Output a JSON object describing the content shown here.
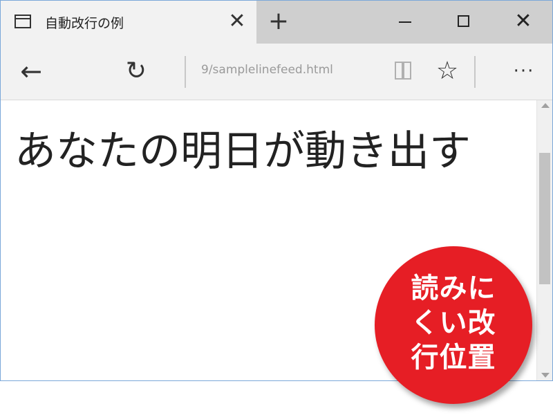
{
  "browser": {
    "tab": {
      "title": "自動改行の例",
      "close_glyph": "✕"
    },
    "new_tab_glyph": "+",
    "window_controls": {
      "close_glyph": "✕"
    },
    "nav": {
      "back_glyph": "←",
      "refresh_glyph": "↻",
      "address": "9/samplelinefeed.html",
      "favorite_glyph": "☆",
      "more_glyph": "···"
    }
  },
  "page": {
    "text": "あなたの明日が動き出す"
  },
  "badge": {
    "lines": [
      "読みに",
      "くい改",
      "行位置"
    ],
    "color": "#e61e25"
  },
  "colors": {
    "window_border": "#7aa7d9",
    "tab_active": "#f2f2f2",
    "tab_strip": "#cfcfcf"
  }
}
